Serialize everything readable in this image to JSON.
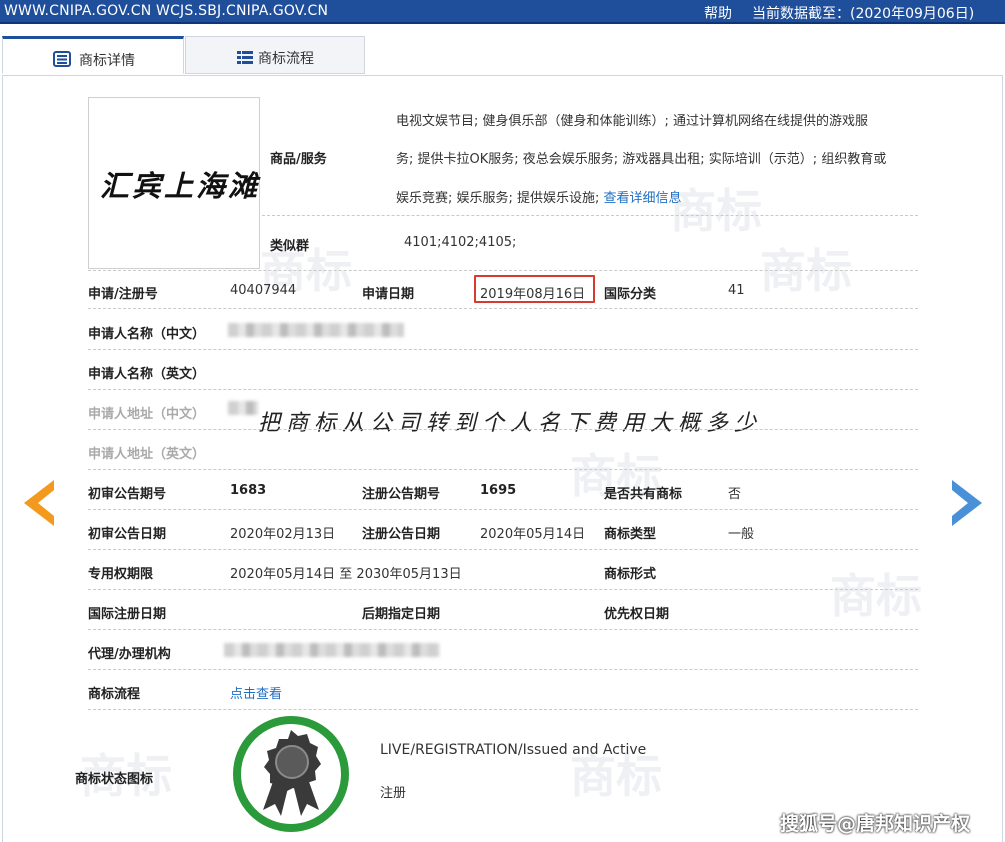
{
  "topbar": {
    "urls": "WWW.CNIPA.GOV.CN WCJS.SBJ.CNIPA.GOV.CN",
    "help": "帮助",
    "cutoff": "当前数据截至：(2020年09月06日)"
  },
  "tabs": [
    {
      "label": "商标详情",
      "icon": "list-document-icon"
    },
    {
      "label": "商标流程",
      "icon": "list-icon"
    }
  ],
  "logo": {
    "text": "汇宾上海滩"
  },
  "goods": {
    "label": "商品/服务",
    "lines": [
      "电视文娱节目; 健身俱乐部（健身和体能训练）; 通过计算机网络在线提供的游戏服",
      "务; 提供卡拉OK服务; 夜总会娱乐服务; 游戏器具出租; 实际培训（示范）; 组织教育或",
      "娱乐竞赛; 娱乐服务; 提供娱乐设施; "
    ],
    "more_link": "查看详细信息"
  },
  "similar_group": {
    "label": "类似群",
    "value": "4101;4102;4105;"
  },
  "reg_no": {
    "label": "申请/注册号",
    "value": "40407944"
  },
  "app_date": {
    "label": "申请日期",
    "value": "2019年08月16日"
  },
  "intl_class": {
    "label": "国际分类",
    "value": "41"
  },
  "applicant_cn": {
    "label": "申请人名称（中文）"
  },
  "applicant_en": {
    "label": "申请人名称（英文）"
  },
  "address_cn": {
    "label": "申请人地址（中文）"
  },
  "address_en": {
    "label": "申请人地址（英文）"
  },
  "overlay_text": "把商标从公司转到个人名下费用大概多少",
  "prelim_no": {
    "label": "初审公告期号",
    "value": "1683"
  },
  "reg_pub_no": {
    "label": "注册公告期号",
    "value": "1695"
  },
  "shared": {
    "label": "是否共有商标",
    "value": "否"
  },
  "prelim_date": {
    "label": "初审公告日期",
    "value": "2020年02月13日"
  },
  "reg_pub_date": {
    "label": "注册公告日期",
    "value": "2020年05月14日"
  },
  "tm_type": {
    "label": "商标类型",
    "value": "一般"
  },
  "exclusive_period": {
    "label": "专用权期限",
    "value": "2020年05月14日 至 2030年05月13日"
  },
  "tm_form": {
    "label": "商标形式"
  },
  "intl_reg_date": {
    "label": "国际注册日期"
  },
  "later_date": {
    "label": "后期指定日期"
  },
  "priority_date": {
    "label": "优先权日期"
  },
  "agent": {
    "label": "代理/办理机构"
  },
  "process": {
    "label": "商标流程",
    "link": "点击查看"
  },
  "status": {
    "label": "商标状态图标",
    "line1": "LIVE/REGISTRATION/Issued and Active",
    "line2": "注册",
    "icon": "award-ribbon-icon"
  },
  "watermark": {
    "text": "商标"
  },
  "footer": {
    "text": "搜狐号@唐邦知识产权"
  },
  "colors": {
    "header": "#1f4e9a",
    "link": "#1f6fc4",
    "highlight": "#d63b2f",
    "badge_ring": "#2a9a3a",
    "prev_arrow": "#f39a1e",
    "next_arrow": "#4a90d9"
  }
}
